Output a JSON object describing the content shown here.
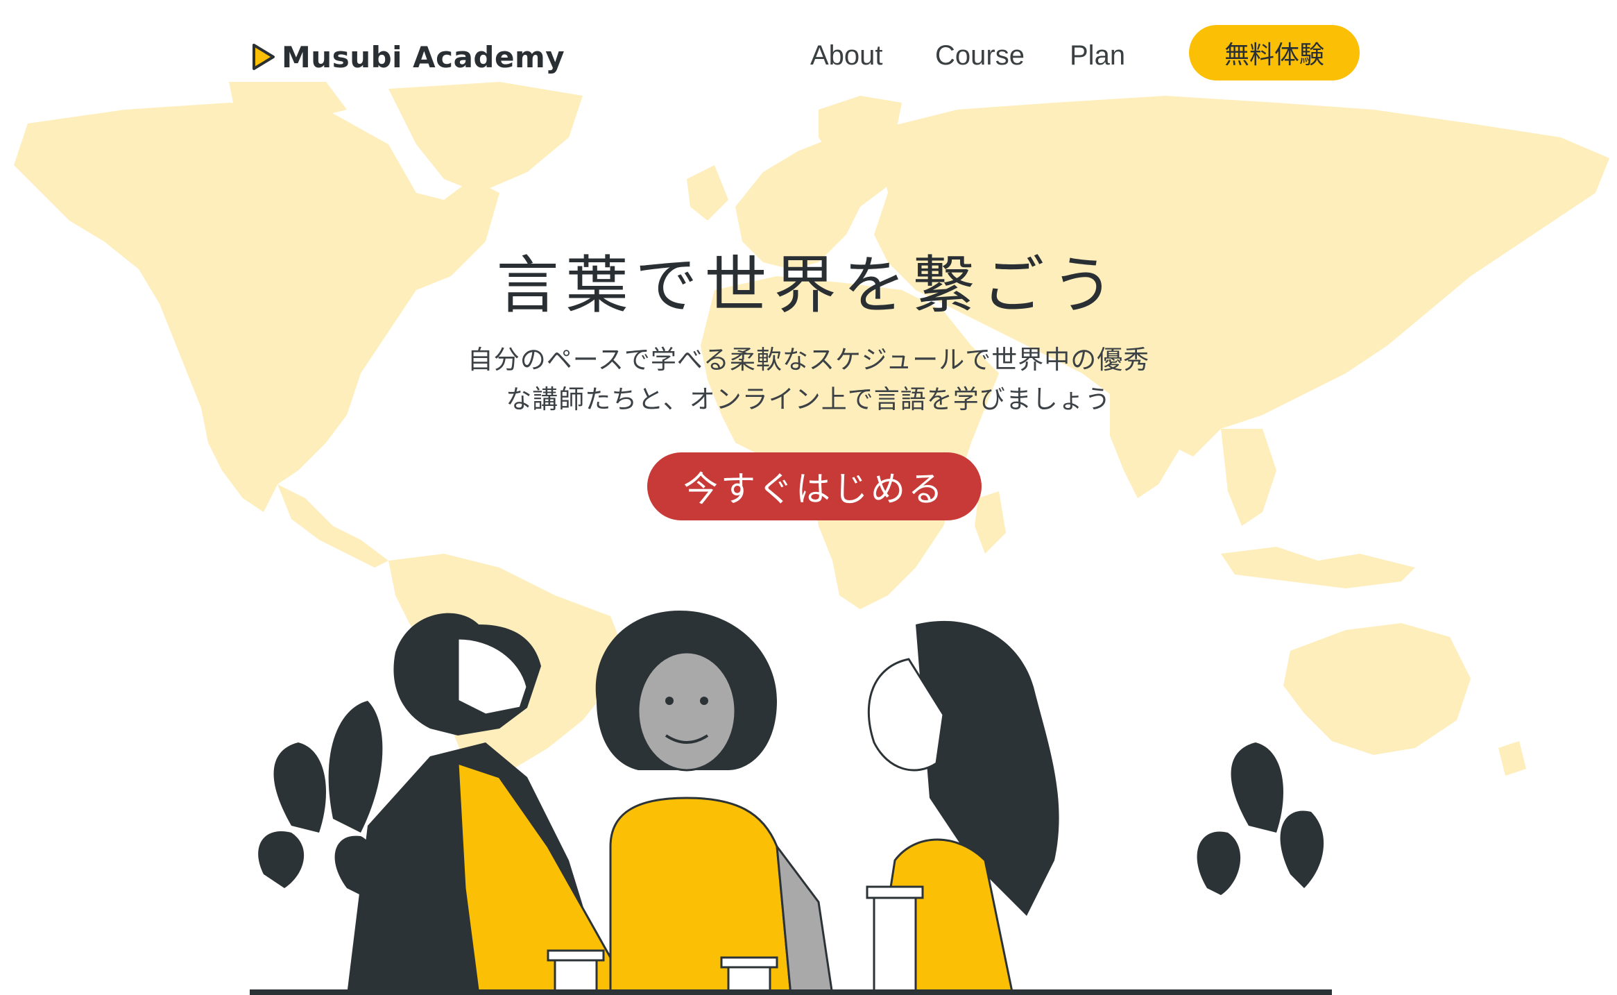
{
  "brand": {
    "name": "Musubi Academy",
    "accent": "#fbbf05",
    "map_color": "#fdeebb",
    "cta_color": "#c73a37"
  },
  "nav": {
    "about": "About",
    "course": "Course",
    "plan": "Plan",
    "trial_button": "無料体験"
  },
  "hero": {
    "title": "言葉で世界を繋ごう",
    "subtitle_line1": "自分のペースで学べる柔軟なスケジュールで世界中の優秀",
    "subtitle_line2": "な講師たちと、オンライン上で言語を学びましょう",
    "cta_label": "今すぐはじめる"
  },
  "icons": {
    "logo": "play-triangle-logo-icon",
    "background": "world-map",
    "illustration": "three-people-conversation"
  }
}
